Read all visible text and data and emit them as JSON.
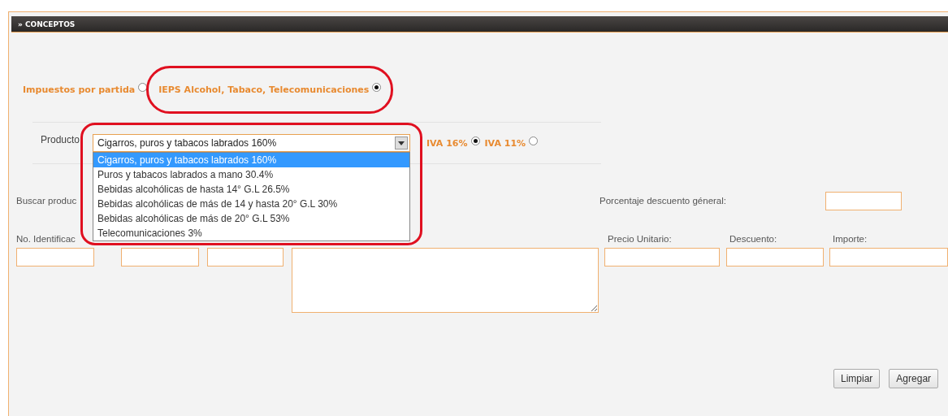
{
  "section": {
    "title": "» CONCEPTOS"
  },
  "tax_mode": [
    {
      "label": "Impuestos por partida",
      "selected": false,
      "highlighted": false
    },
    {
      "label": "IEPS Alcohol, Tabaco, Telecomunicaciones",
      "selected": true,
      "highlighted": true
    }
  ],
  "product": {
    "label": "Producto",
    "value": "Cigarros, puros y tabacos labrados 160%",
    "expanded": true,
    "highlighted": true,
    "options": [
      {
        "label": "Cigarros, puros y tabacos labrados 160%",
        "selected": true
      },
      {
        "label": "Puros y tabacos labrados a mano 30.4%",
        "selected": false
      },
      {
        "label": "Bebidas alcohólicas de hasta 14° G.L 26.5%",
        "selected": false
      },
      {
        "label": "Bebidas alcohólicas de más de 14 y hasta 20° G.L 30%",
        "selected": false
      },
      {
        "label": "Bebidas alcohólicas de más de 20° G.L 53%",
        "selected": false
      },
      {
        "label": "Telecomunicaciones 3%",
        "selected": false
      }
    ]
  },
  "iva": [
    {
      "label": "IVA 16%",
      "selected": true
    },
    {
      "label": "IVA 11%",
      "selected": false
    }
  ],
  "search": {
    "label": "Buscar produc"
  },
  "discount": {
    "label": "Porcentaje descuento géneral:"
  },
  "item_fields": {
    "id_label": "No. Identificac",
    "columns": [
      "Precio Unitario:",
      "Descuento:",
      "Importe:"
    ]
  },
  "buttons": [
    "Limpiar",
    "Agregar"
  ]
}
